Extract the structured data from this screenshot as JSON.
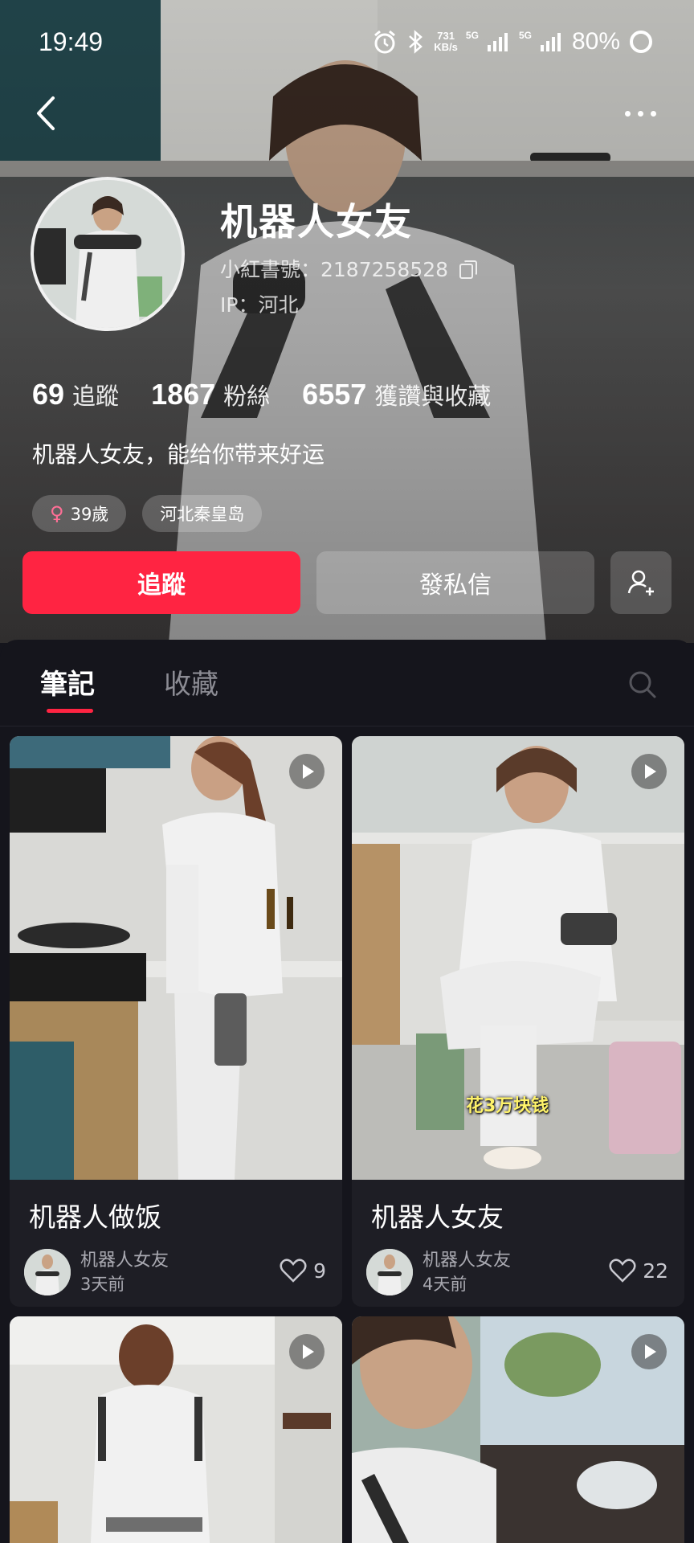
{
  "status_bar": {
    "time": "19:49",
    "net_speed_value": "731",
    "net_speed_unit": "KB/s",
    "signal_1": "5G",
    "signal_2": "5G",
    "battery": "80%"
  },
  "profile": {
    "nickname": "机器人女友",
    "red_id": "小紅書號：2187258528",
    "ip": "IP：河北",
    "bio": "机器人女友，能给你带来好运",
    "stats": [
      {
        "value": "69",
        "label": "追蹤"
      },
      {
        "value": "1867",
        "label": "粉絲"
      },
      {
        "value": "6557",
        "label": "獲讚與收藏"
      }
    ],
    "tags": [
      {
        "text": "39歲",
        "icon": "female-icon"
      },
      {
        "text": "河北秦皇岛"
      }
    ]
  },
  "actions": {
    "follow_label": "追蹤",
    "message_label": "發私信"
  },
  "tabs": [
    {
      "label": "筆記",
      "active": true
    },
    {
      "label": "收藏",
      "active": false
    }
  ],
  "notes": [
    {
      "title": "机器人做饭",
      "author": "机器人女友",
      "ago": "3天前",
      "likes": "9",
      "has_video": true
    },
    {
      "title": "机器人女友",
      "author": "机器人女友",
      "ago": "4天前",
      "likes": "22",
      "has_video": true,
      "caption": "花3万块钱"
    },
    {
      "title": "",
      "author": "",
      "ago": "",
      "likes": "",
      "has_video": true
    },
    {
      "title": "",
      "author": "",
      "ago": "",
      "likes": "",
      "has_video": true
    }
  ],
  "colors": {
    "accent": "#ff2442",
    "panel_bg": "#15151c",
    "card_bg": "#1e1e25",
    "female": "#ff6f96"
  }
}
